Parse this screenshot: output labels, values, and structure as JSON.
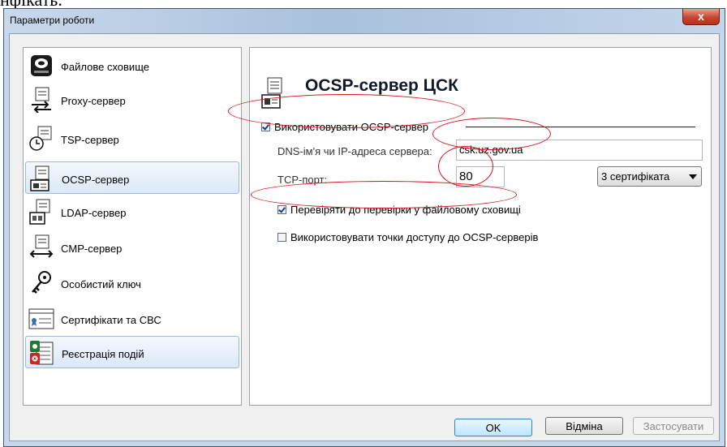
{
  "cropped_text": "нфікать.",
  "window": {
    "title": "Параметри роботи",
    "close_glyph": "x"
  },
  "sidebar": {
    "items": [
      {
        "label": "Файлове сховище",
        "icon": "hard-drive-icon",
        "selected": false
      },
      {
        "label": "Proxy-сервер",
        "icon": "proxy-server-icon",
        "selected": false
      },
      {
        "label": "TSP-сервер",
        "icon": "tsp-server-icon",
        "selected": false
      },
      {
        "label": "OCSP-сервер",
        "icon": "ocsp-server-icon",
        "selected": true
      },
      {
        "label": "LDAP-сервер",
        "icon": "ldap-server-icon",
        "selected": false
      },
      {
        "label": "CMP-сервер",
        "icon": "cmp-server-icon",
        "selected": false
      },
      {
        "label": "Особистий ключ",
        "icon": "keys-icon",
        "selected": false
      },
      {
        "label": "Сертифікати та СВС",
        "icon": "certificate-icon",
        "selected": false
      },
      {
        "label": "Реєстрація подій",
        "icon": "event-log-icon",
        "selected": true
      }
    ]
  },
  "content": {
    "title": "OCSP-сервер ЦСК",
    "use_ocsp": {
      "label": "Використовувати OCSP-сервер",
      "checked": true
    },
    "dns": {
      "label": "DNS-ім'я чи IP-адреса сервера:",
      "value": "csk.uz.gov.ua"
    },
    "tcp": {
      "label": "TCP-порт:",
      "value": "80"
    },
    "cert_dropdown": {
      "value": "3 сертифіката"
    },
    "check_file_store": {
      "label": "Перевіряти до перевірки у файловому сховищі",
      "checked": true
    },
    "use_access_points": {
      "label": "Використовувати точки доступу до OCSP-серверів",
      "checked": false
    }
  },
  "buttons": {
    "ok": "OK",
    "cancel": "Відміна",
    "apply": "Застосувати"
  },
  "colors": {
    "annotation": "#d8161d",
    "accent": "#3c7fb1"
  }
}
